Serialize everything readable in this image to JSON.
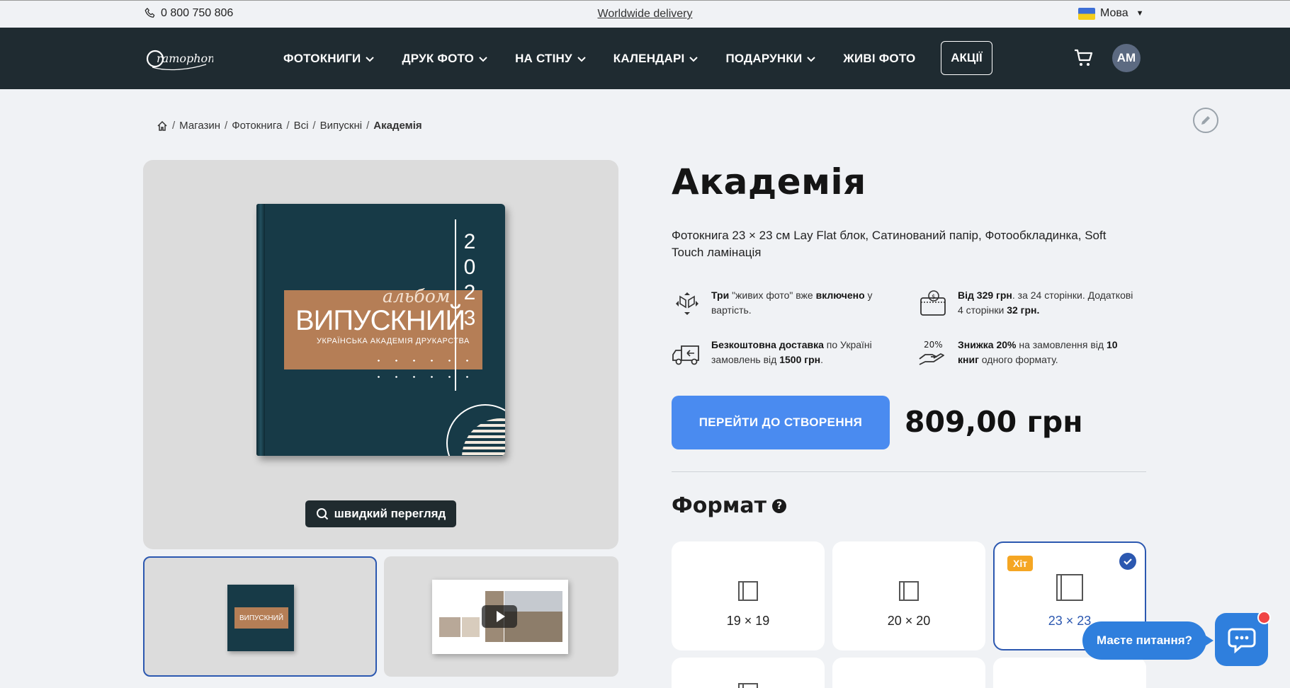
{
  "topbar": {
    "phone": "0 800 750 806",
    "delivery": "Worldwide delivery",
    "language": "Мова"
  },
  "nav": {
    "logo_text": "Gramophone",
    "items": [
      {
        "label": "ФОТОКНИГИ"
      },
      {
        "label": "ДРУК ФОТО"
      },
      {
        "label": "НА СТІНУ"
      },
      {
        "label": "КАЛЕНДАРІ"
      },
      {
        "label": "ПОДАРУНКИ"
      },
      {
        "label": "ЖИВІ ФОТО"
      }
    ],
    "promo": "АКЦІЇ",
    "avatar": "AM"
  },
  "breadcrumb": [
    "Магазин",
    "Фотокнига",
    "Всі",
    "Випускні",
    "Академія"
  ],
  "gallery": {
    "cover": {
      "script": "альбом",
      "title": "ВИПУСКНИЙ",
      "subtitle": "УКРАЇНСЬКА АКАДЕМІЯ ДРУКАРСТВА",
      "year_digits": [
        "2",
        "0",
        "2",
        "3"
      ]
    },
    "quick_view": "швидкий перегляд",
    "mini_title": "ВИПУСКНИЙ"
  },
  "product": {
    "title": "Академія",
    "description": "Фотокнига 23 × 23 см Lay Flat блок, Сатинований папір, Фотообкладинка, Soft Touch ламінація",
    "features": [
      {
        "bold1": "Три",
        "text1": " \"живих фото\" вже ",
        "bold2": "включено",
        "text2": " у вартість."
      },
      {
        "bold1": "Від 329 грн",
        "text1": ". за 24 сторінки. Додаткові 4 сторінки ",
        "bold2": "32 грн.",
        "text2": ""
      },
      {
        "bold1": "Безкоштовна доставка",
        "text1": " по Україні замовлень від ",
        "bold2": "1500 грн",
        "text2": "."
      },
      {
        "bold1": "Знижка 20%",
        "text1": " на замовлення від ",
        "bold2": "10 книг",
        "text2": " одного формату."
      }
    ],
    "discount_icon_text": "20%",
    "cta": "ПЕРЕЙТИ ДО СТВОРЕННЯ",
    "price": "809,00 грн",
    "format_title": "Формат",
    "formats": [
      {
        "label": "19 × 19",
        "selected": false
      },
      {
        "label": "20 × 20",
        "selected": false
      },
      {
        "label": "23 × 23",
        "selected": true,
        "badge": "Хіт"
      }
    ]
  },
  "chat": {
    "bubble": "Маєте питання?"
  },
  "colors": {
    "nav_bg": "#1f2b31",
    "accent": "#4a8bf0",
    "selected_border": "#2c58b0",
    "badge": "#f5a623"
  }
}
